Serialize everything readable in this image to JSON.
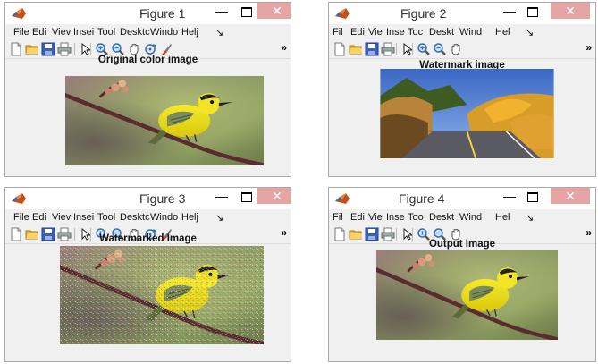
{
  "windows": [
    {
      "title": "Figure 1",
      "menu": [
        "File",
        "Edi",
        "Viev",
        "Insei",
        "Tool",
        "Desktc",
        "Windo",
        "Helj",
        "↘"
      ],
      "axes_title": "Original color image",
      "image": "bird-on-branch"
    },
    {
      "title": "Figure 2",
      "menu": [
        "Fil",
        "Edi",
        "Vie",
        "Inse",
        "Toc",
        "Deskt",
        "Wind",
        "Hel",
        "↘"
      ],
      "axes_title": "Watermark image",
      "image": "autumn-road"
    },
    {
      "title": "Figure 3",
      "menu": [
        "File",
        "Edi",
        "Viev",
        "Insei",
        "Tool",
        "Desktc",
        "Windo",
        "Helj",
        "↘"
      ],
      "axes_title": "Watermarked Image",
      "image": "noisy-bird-on-branch"
    },
    {
      "title": "Figure 4",
      "menu": [
        "Fil",
        "Edi",
        "Vie",
        "Inse",
        "Too",
        "Deskt",
        "Wind",
        "Hel",
        "↘"
      ],
      "axes_title": "Output Image",
      "image": "bird-on-branch"
    }
  ],
  "controls": {
    "minimize": "—",
    "close": "✕"
  },
  "toolbar_overflow": "»",
  "colors": {
    "titlebar": "#ffffff",
    "close_button": "#e5a5a5",
    "window_bg": "#f0f0f0"
  },
  "toolbar_icons": [
    "new-file-icon",
    "open-folder-icon",
    "save-icon",
    "print-icon",
    "pointer-icon",
    "zoom-in-icon",
    "zoom-out-icon",
    "pan-hand-icon",
    "rotate-3d-icon",
    "data-brush-icon"
  ]
}
